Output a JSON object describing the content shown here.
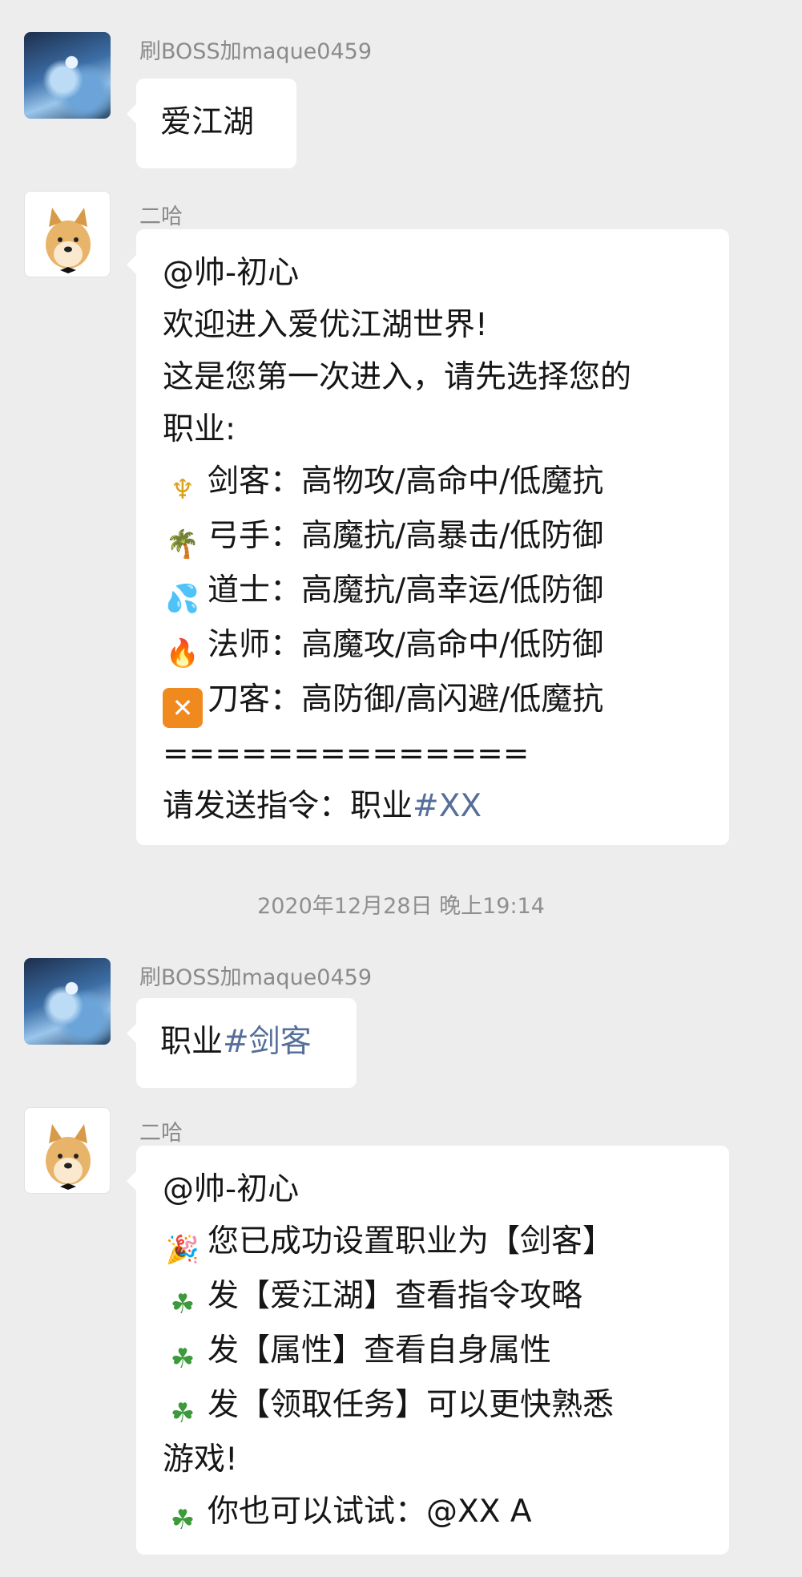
{
  "messages": [
    {
      "sender": "刷BOSS加maque0459",
      "lines": [
        "爱江湖"
      ]
    },
    {
      "sender": "二哈",
      "lines": [
        "@帅-初心",
        "欢迎进入爱优江湖世界!",
        "这是您第一次进入，请先选择您的",
        "职业:",
        "剑客：高物攻/高命中/低魔抗",
        "弓手：高魔抗/高暴击/低防御",
        "道士：高魔抗/高幸运/低防御",
        "法师：高魔攻/高命中/低防御",
        "刀客：高防御/高闪避/低魔抗",
        "==============",
        "请发送指令：职业",
        "#XX"
      ]
    },
    {
      "sender": "刷BOSS加maque0459",
      "lines": [
        "职业",
        "#剑客"
      ]
    },
    {
      "sender": "二哈",
      "lines": [
        "@帅-初心",
        "您已成功设置职业为【剑客】",
        "发【爱江湖】查看指令攻略",
        "发【属性】查看自身属性",
        "发【领取任务】可以更快熟悉",
        "游戏!",
        "你也可以试试：@XX A"
      ]
    }
  ],
  "timestamp": "2020年12月28日 晚上19:14",
  "icons": {
    "sword": "trident-emoji",
    "archer": "palm-tree-emoji",
    "taoist": "sweat-droplets-emoji",
    "mage": "fire-emoji",
    "blade": "cross-box-emoji",
    "party": "party-popper-emoji",
    "clover": "four-leaf-clover-emoji"
  },
  "colors": {
    "background": "#ededed",
    "bubble": "#ffffff",
    "hashtag": "#556f9a",
    "sender": "#8a8a8a"
  }
}
